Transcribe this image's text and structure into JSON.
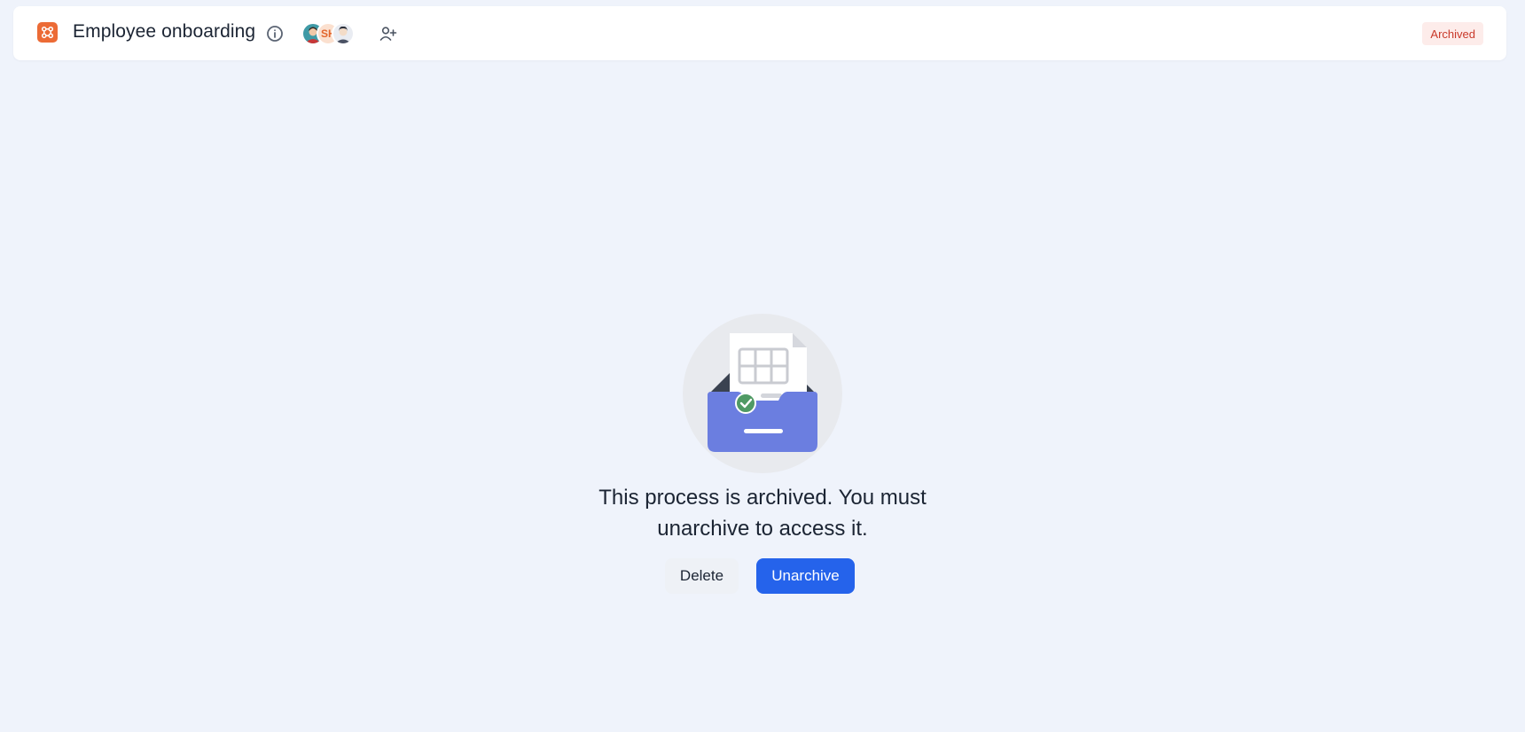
{
  "header": {
    "title": "Employee onboarding",
    "status": "Archived",
    "avatars": [
      {
        "name": "member-1",
        "initials": ""
      },
      {
        "name": "member-2",
        "initials": "SH"
      },
      {
        "name": "member-3",
        "initials": ""
      }
    ],
    "icons": {
      "logo": "process-logo-icon",
      "info": "info-icon",
      "add_member": "add-user-icon"
    }
  },
  "empty_state": {
    "message": "This process is archived. You must unarchive to access it.",
    "illustration": "archived-inbox-illustration"
  },
  "actions": {
    "delete_label": "Delete",
    "unarchive_label": "Unarchive"
  },
  "colors": {
    "background": "#eff3fb",
    "brand": "#ec6b36",
    "primary": "#2563eb",
    "archived_badge_bg": "#fdecea",
    "archived_badge_text": "#c9392a",
    "tray": "#6b7ee0"
  }
}
